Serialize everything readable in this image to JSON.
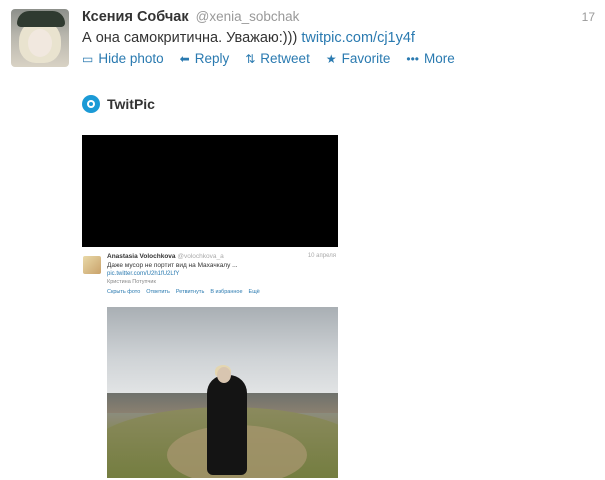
{
  "tweet": {
    "author_name": "Ксения Собчак",
    "author_handle": "@xenia_sobchak",
    "time": "17",
    "text": "А она самокритична. Уважаю:)))",
    "link": "twitpic.com/cj1y4f"
  },
  "actions": {
    "hide_photo": "Hide photo",
    "reply": "Reply",
    "retweet": "Retweet",
    "favorite": "Favorite",
    "more": "More"
  },
  "media": {
    "provider": "TwitPic"
  },
  "embedded_tweet": {
    "author_name": "Anastasia Volochkova",
    "author_handle": "@volochkova_a",
    "time": "10 апреля",
    "text": "Даже мусор не портит вид на Махачкалу ...",
    "link": "pic.twitter.com/U2h1fU2LfY",
    "place": "Кристина Потупчик",
    "actions": [
      "Скрыть фото",
      "Ответить",
      "Ретвитнуть",
      "В избранное",
      "Ещё"
    ]
  },
  "colors": {
    "link": "#2a7ab0",
    "twitpic_brand": "#1b9ad6"
  }
}
